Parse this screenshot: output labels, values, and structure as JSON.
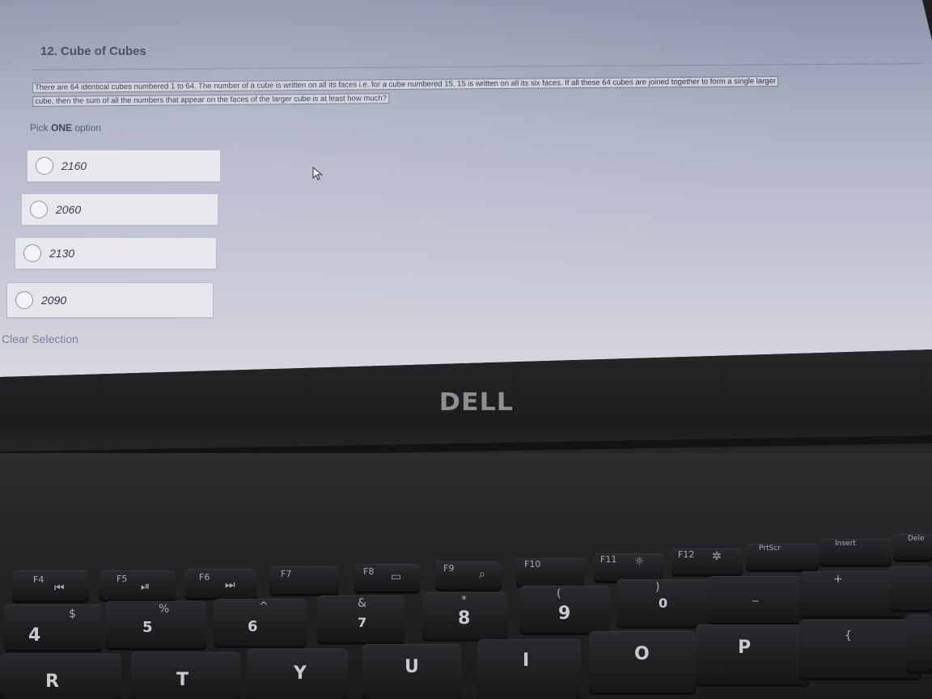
{
  "question": {
    "title": "12. Cube of Cubes",
    "text_line1": "There are 64 identical cubes numbered 1 to 64. The number of a cube is written on all its faces i.e. for a cube numbered 15, 15 is written on all its six faces. If all these 64 cubes are joined together to form a single larger",
    "text_line2": "cube, then the sum of all the numbers that appear on the faces of the larger cube is at least how much?",
    "pick_prefix": "Pick",
    "pick_bold": "ONE",
    "pick_suffix": "option"
  },
  "options": [
    {
      "label": "2160"
    },
    {
      "label": "2060"
    },
    {
      "label": "2130"
    },
    {
      "label": "2090"
    }
  ],
  "clear_selection": "Clear Selection",
  "laptop": {
    "brand": "DELL"
  },
  "keyboard": {
    "f4": "F4",
    "f5": "F5",
    "f6": "F6",
    "f7": "F7",
    "f8": "F8",
    "f9": "F9",
    "f10": "F10",
    "f11": "F11",
    "f12": "F12",
    "prtsc": "PrtScr",
    "insert": "Insert",
    "delete": "Dele",
    "dollar": "$",
    "four": "4",
    "percent": "%",
    "five": "5",
    "caret": "^",
    "six": "6",
    "amp": "&",
    "seven": "7",
    "star": "*",
    "eight": "8",
    "lparen": "(",
    "nine": "9",
    "rparen": ")",
    "zero": "0",
    "minus": "_",
    "plus": "+",
    "r": "R",
    "t": "T",
    "y": "Y",
    "u": "U",
    "i": "I",
    "o": "O",
    "p": "P",
    "brace": "{"
  },
  "colors": {
    "screen_bg": "#b4b8ca",
    "option_bg": "#e7e6ec",
    "title": "#3a3f55",
    "bezel": "#1e1f21"
  }
}
